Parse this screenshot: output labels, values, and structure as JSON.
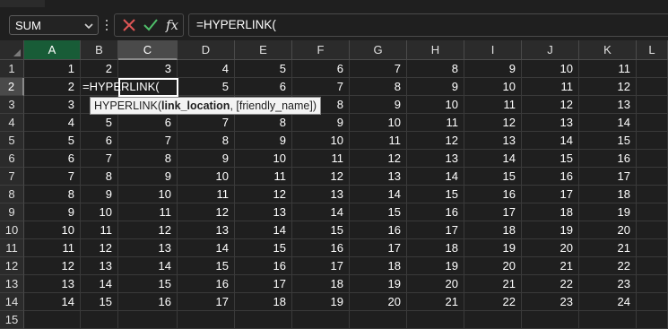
{
  "name_box": {
    "value": "SUM"
  },
  "formula_bar": {
    "fx_label": "fx",
    "formula": "=HYPERLINK("
  },
  "columns": [
    "A",
    "B",
    "C",
    "D",
    "E",
    "F",
    "G",
    "H",
    "I",
    "J",
    "K",
    "L"
  ],
  "active_column": "C",
  "active_row": 2,
  "editing_cell": {
    "ref": "C2",
    "text": "=HYPERLINK("
  },
  "tooltip": {
    "fn_name": "HYPERLINK(",
    "arg1": "link_location",
    "rest": ", [friendly_name])"
  },
  "rows": [
    {
      "num": "1",
      "cells": [
        "1",
        "2",
        "3",
        "4",
        "5",
        "6",
        "7",
        "8",
        "9",
        "10",
        "11",
        ""
      ]
    },
    {
      "num": "2",
      "cells": [
        "2",
        "",
        "",
        "5",
        "6",
        "7",
        "8",
        "9",
        "10",
        "11",
        "12",
        ""
      ]
    },
    {
      "num": "3",
      "cells": [
        "3",
        "",
        "",
        "",
        "",
        "8",
        "9",
        "10",
        "11",
        "12",
        "13",
        ""
      ]
    },
    {
      "num": "4",
      "cells": [
        "4",
        "5",
        "6",
        "7",
        "8",
        "9",
        "10",
        "11",
        "12",
        "13",
        "14",
        ""
      ]
    },
    {
      "num": "5",
      "cells": [
        "5",
        "6",
        "7",
        "8",
        "9",
        "10",
        "11",
        "12",
        "13",
        "14",
        "15",
        ""
      ]
    },
    {
      "num": "6",
      "cells": [
        "6",
        "7",
        "8",
        "9",
        "10",
        "11",
        "12",
        "13",
        "14",
        "15",
        "16",
        ""
      ]
    },
    {
      "num": "7",
      "cells": [
        "7",
        "8",
        "9",
        "10",
        "11",
        "12",
        "13",
        "14",
        "15",
        "16",
        "17",
        ""
      ]
    },
    {
      "num": "8",
      "cells": [
        "8",
        "9",
        "10",
        "11",
        "12",
        "13",
        "14",
        "15",
        "16",
        "17",
        "18",
        ""
      ]
    },
    {
      "num": "9",
      "cells": [
        "9",
        "10",
        "11",
        "12",
        "13",
        "14",
        "15",
        "16",
        "17",
        "18",
        "19",
        ""
      ]
    },
    {
      "num": "10",
      "cells": [
        "10",
        "11",
        "12",
        "13",
        "14",
        "15",
        "16",
        "17",
        "18",
        "19",
        "20",
        ""
      ]
    },
    {
      "num": "11",
      "cells": [
        "11",
        "12",
        "13",
        "14",
        "15",
        "16",
        "17",
        "18",
        "19",
        "20",
        "21",
        ""
      ]
    },
    {
      "num": "12",
      "cells": [
        "12",
        "13",
        "14",
        "15",
        "16",
        "17",
        "18",
        "19",
        "20",
        "21",
        "22",
        ""
      ]
    },
    {
      "num": "13",
      "cells": [
        "13",
        "14",
        "15",
        "16",
        "17",
        "18",
        "19",
        "20",
        "21",
        "22",
        "23",
        ""
      ]
    },
    {
      "num": "14",
      "cells": [
        "14",
        "15",
        "16",
        "17",
        "18",
        "19",
        "20",
        "21",
        "22",
        "23",
        "24",
        ""
      ]
    },
    {
      "num": "15",
      "cells": [
        "",
        "",
        "",
        "",
        "",
        "",
        "",
        "",
        "",
        "",
        "",
        ""
      ]
    }
  ]
}
